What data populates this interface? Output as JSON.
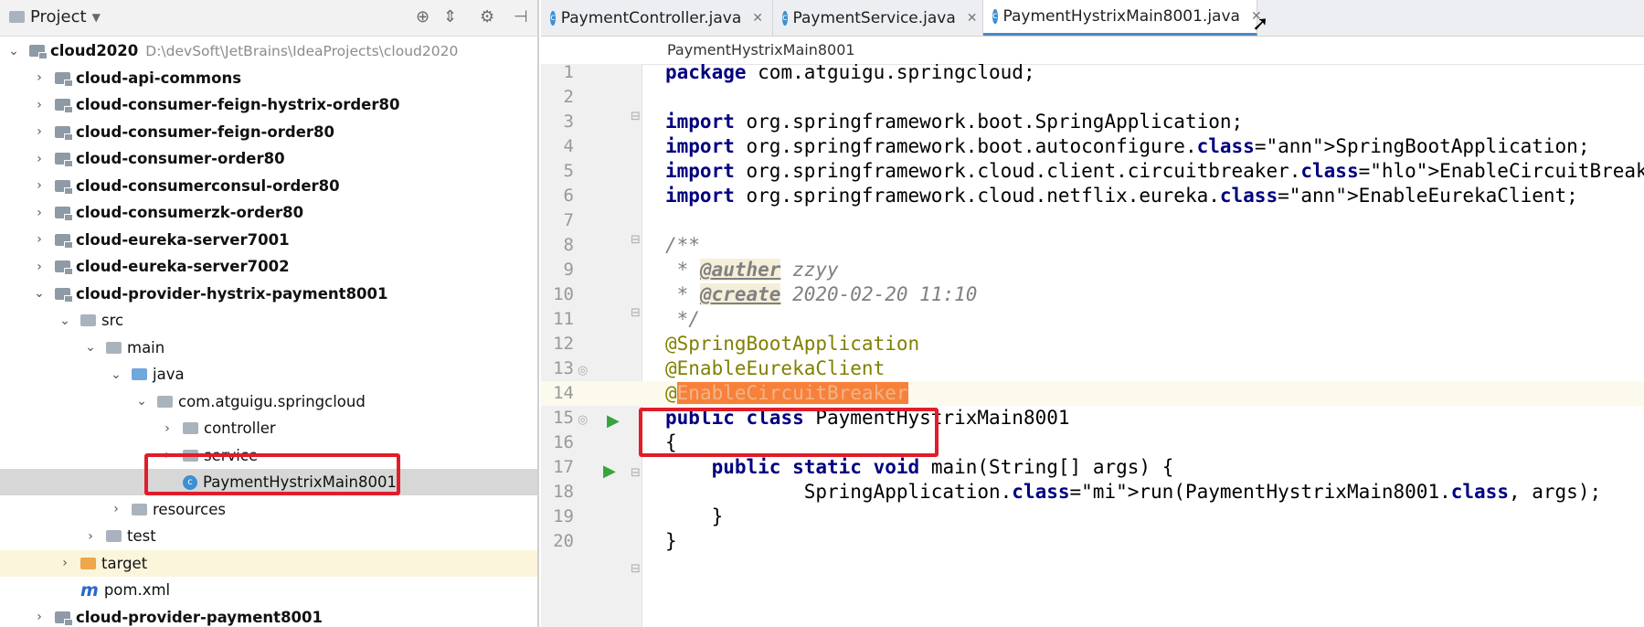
{
  "project_panel": {
    "title": "Project",
    "toolbar_icons": [
      "target-icon",
      "collapse-icon",
      "gear-icon",
      "hide-icon"
    ],
    "tree": [
      {
        "label": "cloud2020",
        "path": "D:\\devSoft\\JetBrains\\IdeaProjects\\cloud2020",
        "icon": "module-folder",
        "arrow": "down"
      },
      {
        "label": "cloud-api-commons",
        "icon": "module-folder",
        "arrow": "right"
      },
      {
        "label": "cloud-consumer-feign-hystrix-order80",
        "icon": "module-folder",
        "arrow": "right"
      },
      {
        "label": "cloud-consumer-feign-order80",
        "icon": "module-folder",
        "arrow": "right"
      },
      {
        "label": "cloud-consumer-order80",
        "icon": "module-folder",
        "arrow": "right"
      },
      {
        "label": "cloud-consumerconsul-order80",
        "icon": "module-folder",
        "arrow": "right"
      },
      {
        "label": "cloud-consumerzk-order80",
        "icon": "module-folder",
        "arrow": "right"
      },
      {
        "label": "cloud-eureka-server7001",
        "icon": "module-folder",
        "arrow": "right"
      },
      {
        "label": "cloud-eureka-server7002",
        "icon": "module-folder",
        "arrow": "right"
      },
      {
        "label": "cloud-provider-hystrix-payment8001",
        "icon": "module-folder",
        "arrow": "down"
      },
      {
        "label": "src",
        "icon": "folder",
        "arrow": "down"
      },
      {
        "label": "main",
        "icon": "folder",
        "arrow": "down"
      },
      {
        "label": "java",
        "icon": "source-folder",
        "arrow": "down"
      },
      {
        "label": "com.atguigu.springcloud",
        "icon": "package",
        "arrow": "down"
      },
      {
        "label": "controller",
        "icon": "package",
        "arrow": "right"
      },
      {
        "label": "service",
        "icon": "package",
        "arrow": "right"
      },
      {
        "label": "PaymentHystrixMain8001",
        "icon": "spring-class",
        "arrow": "",
        "selected": true
      },
      {
        "label": "resources",
        "icon": "resources-folder",
        "arrow": "right"
      },
      {
        "label": "test",
        "icon": "folder",
        "arrow": "right"
      },
      {
        "label": "target",
        "icon": "excluded-folder",
        "arrow": "right"
      },
      {
        "label": "pom.xml",
        "icon": "maven-file",
        "arrow": ""
      },
      {
        "label": "cloud-provider-payment8001",
        "icon": "module-folder",
        "arrow": "right"
      }
    ]
  },
  "editor": {
    "tabs": [
      {
        "label": "PaymentController.java",
        "active": false
      },
      {
        "label": "PaymentService.java",
        "active": false
      },
      {
        "label": "PaymentHystrixMain8001.java",
        "active": true
      }
    ],
    "breadcrumb": "PaymentHystrixMain8001",
    "lines": [
      {
        "n": "1",
        "text": "package com.atguigu.springcloud;"
      },
      {
        "n": "2",
        "text": ""
      },
      {
        "n": "3",
        "text": "import org.springframework.boot.SpringApplication;"
      },
      {
        "n": "4",
        "text": "import org.springframework.boot.autoconfigure.SpringBootApplication;"
      },
      {
        "n": "5",
        "text": "import org.springframework.cloud.client.circuitbreaker.EnableCircuitBreaker;"
      },
      {
        "n": "6",
        "text": "import org.springframework.cloud.netflix.eureka.EnableEurekaClient;"
      },
      {
        "n": "7",
        "text": ""
      },
      {
        "n": "8",
        "text": "/**"
      },
      {
        "n": "9",
        "text": " * @auther zzyy"
      },
      {
        "n": "10",
        "text": " * @create 2020-02-20 11:10"
      },
      {
        "n": "11",
        "text": " */"
      },
      {
        "n": "12",
        "text": "@SpringBootApplication"
      },
      {
        "n": "13",
        "text": "@EnableEurekaClient"
      },
      {
        "n": "14",
        "text": "@EnableCircuitBreaker"
      },
      {
        "n": "15",
        "text": "public class PaymentHystrixMain8001"
      },
      {
        "n": "16",
        "text": "{"
      },
      {
        "n": "17",
        "text": "    public static void main(String[] args) {"
      },
      {
        "n": "18",
        "text": "            SpringApplication.run(PaymentHystrixMain8001.class, args);"
      },
      {
        "n": "19",
        "text": "    }"
      },
      {
        "n": "20",
        "text": "}"
      }
    ]
  },
  "colors": {
    "keyword": "#000080",
    "annotation": "#808000",
    "comment": "#808080",
    "highlight": "#f7813a",
    "red_box": "#e11d2a"
  }
}
